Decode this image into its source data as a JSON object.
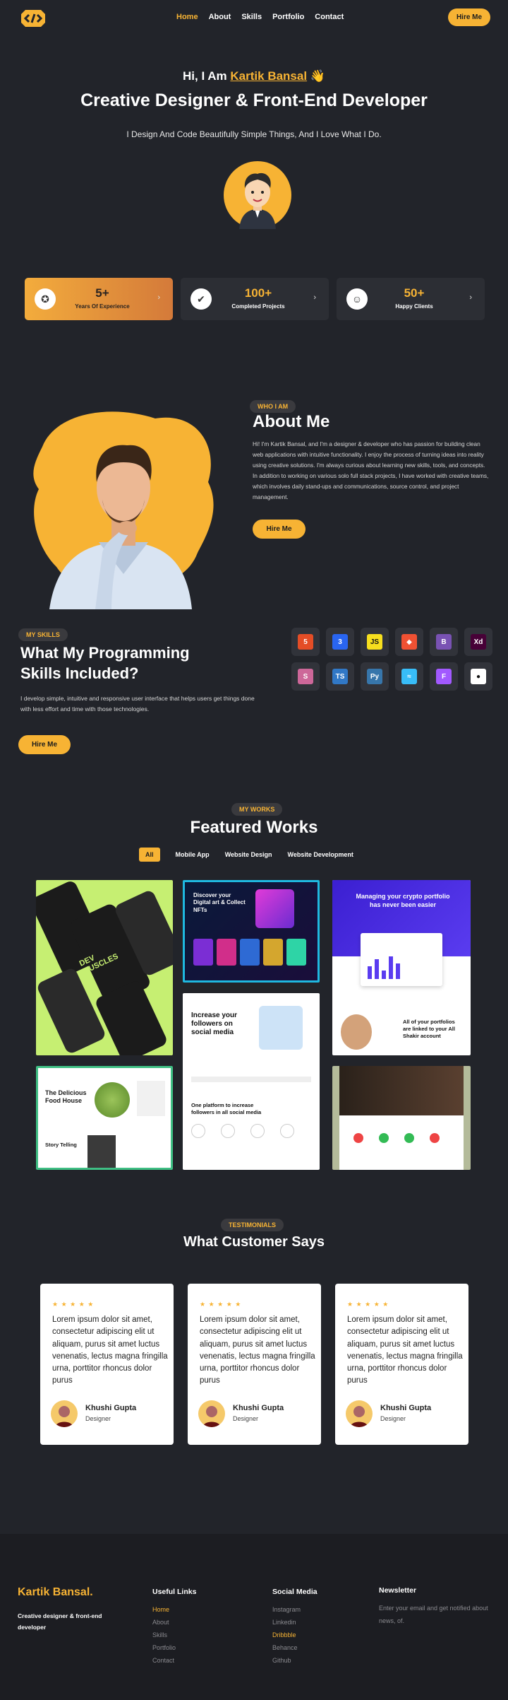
{
  "nav": {
    "links": [
      "Home",
      "About",
      "Skills",
      "Portfolio",
      "Contact"
    ],
    "cta": "Hire Me"
  },
  "hero": {
    "greeting": "Hi, I Am",
    "name": "Kartik Bansal",
    "wave": "👋",
    "title": "Creative Designer & Front-End Developer",
    "subtitle": "I Design And Code Beautifully Simple Things, And I Love What I Do."
  },
  "stats": [
    {
      "num": "5+",
      "label": "Years Of Experience",
      "icon": "award-icon"
    },
    {
      "num": "100+",
      "label": "Completed Projects",
      "icon": "check-badge-icon"
    },
    {
      "num": "50+",
      "label": "Happy Clients",
      "icon": "users-icon"
    }
  ],
  "about": {
    "tag": "WHO I AM",
    "title": "About Me",
    "text": "Hi! I'm Kartik Bansal, and I'm a designer & developer who has passion for building clean web applications with intuitive functionality. I enjoy the process of turning ideas into reality using creative solutions. I'm always curious about learning new skills, tools, and concepts. In addition to working on various solo full stack projects, I have worked with creative teams, which involves daily stand-ups and communications, source control, and project management.",
    "cta": "Hire Me"
  },
  "skills": {
    "tag": "MY SKILLS",
    "title": "What My Programming Skills Included?",
    "text": "I develop simple, intuitive and responsive user interface that helps users get things done with less effort and time with those technologies.",
    "cta": "Hire Me",
    "icons": [
      {
        "name": "html5-icon",
        "glyph": "5",
        "color": "#e44d26"
      },
      {
        "name": "css3-icon",
        "glyph": "3",
        "color": "#2965f1"
      },
      {
        "name": "javascript-icon",
        "glyph": "JS",
        "color": "#f7df1e"
      },
      {
        "name": "git-icon",
        "glyph": "◆",
        "color": "#f05133"
      },
      {
        "name": "bootstrap-icon",
        "glyph": "B",
        "color": "#7952b3"
      },
      {
        "name": "adobe-xd-icon",
        "glyph": "Xd",
        "color": "#470137"
      },
      {
        "name": "sass-icon",
        "glyph": "S",
        "color": "#cd6799"
      },
      {
        "name": "typescript-icon",
        "glyph": "TS",
        "color": "#3178c6"
      },
      {
        "name": "python-icon",
        "glyph": "Py",
        "color": "#3776ab"
      },
      {
        "name": "tailwind-icon",
        "glyph": "≈",
        "color": "#38bdf8"
      },
      {
        "name": "figma-icon",
        "glyph": "F",
        "color": "#a259ff"
      },
      {
        "name": "github-icon",
        "glyph": "●",
        "color": "#ffffff"
      }
    ]
  },
  "works": {
    "tag": "MY WORKS",
    "title": "Featured Works",
    "filters": [
      "All",
      "Mobile App",
      "Website Design",
      "Website Development"
    ],
    "tiles": {
      "nft": "Discover your Digital art & Collect NFTs",
      "crypto": "Managing your crypto portfolio has never been easier",
      "crypto_sub": "All of your portfolios are linked to your All Shakir account",
      "social": "Increase your followers on social media",
      "social_sub": "One platform to increase followers in all social media",
      "food": "The Delicious Food House",
      "food_sub": "Story Telling",
      "app": "DEV MUSCLES"
    }
  },
  "testimonials": {
    "tag": "TESTIMONIALS",
    "title": "What Customer Says",
    "cards": [
      {
        "stars": "★ ★ ★ ★ ★",
        "quote": "Lorem ipsum dolor sit amet, consectetur adipiscing elit ut aliquam, purus sit amet luctus venenatis, lectus magna fringilla urna, porttitor rhoncus dolor purus",
        "name": "Khushi Gupta",
        "role": "Designer"
      },
      {
        "stars": "★ ★ ★ ★ ★",
        "quote": "Lorem ipsum dolor sit amet, consectetur adipiscing elit ut aliquam, purus sit amet luctus venenatis, lectus magna fringilla urna, porttitor rhoncus dolor purus",
        "name": "Khushi Gupta",
        "role": "Designer"
      },
      {
        "stars": "★ ★ ★ ★ ★",
        "quote": "Lorem ipsum dolor sit amet, consectetur adipiscing elit ut aliquam, purus sit amet luctus venenatis, lectus magna fringilla urna, porttitor rhoncus dolor purus",
        "name": "Khushi Gupta",
        "role": "Designer"
      }
    ]
  },
  "footer": {
    "brand": "Kartik Bansal.",
    "tagline": "Creative designer & front-end developer",
    "useful_title": "Useful Links",
    "useful": [
      "Home",
      "About",
      "Skills",
      "Portfolio",
      "Contact"
    ],
    "social_title": "Social Media",
    "social": [
      "Instagram",
      "Linkedin",
      "Dribbble",
      "Behance",
      "Github"
    ],
    "news_title": "Newsletter",
    "news_text": "Enter your email and get notified about news, of."
  },
  "colors": {
    "accent": "#f7b334",
    "bg": "#22242a",
    "card": "#2c2e34"
  }
}
